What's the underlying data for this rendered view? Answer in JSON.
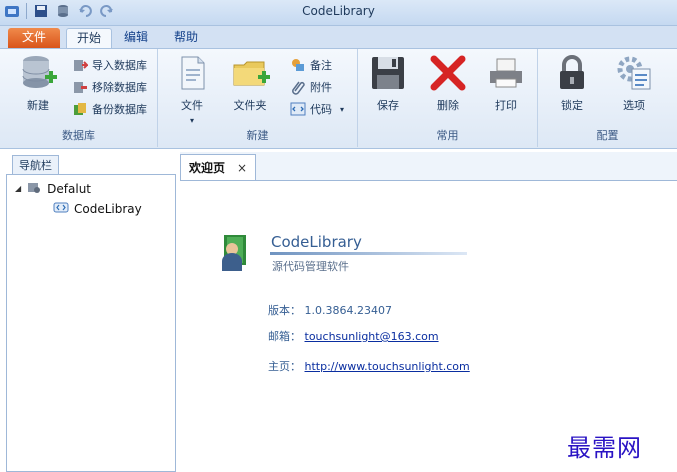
{
  "window": {
    "title": "CodeLibrary"
  },
  "ribbon_tabs": {
    "file": "文件",
    "home": "开始",
    "edit": "编辑",
    "help": "帮助"
  },
  "groups": {
    "database": {
      "label": "数据库",
      "new": "新建",
      "import": "导入数据库",
      "remove": "移除数据库",
      "backup": "备份数据库"
    },
    "create": {
      "label": "新建",
      "file": "文件",
      "folder": "文件夹",
      "note": "备注",
      "attachment": "附件",
      "code": "代码"
    },
    "common": {
      "label": "常用",
      "save": "保存",
      "delete": "删除",
      "print": "打印"
    },
    "config": {
      "label": "配置",
      "lock": "锁定",
      "options": "选项"
    }
  },
  "nav": {
    "header": "导航栏",
    "root": "Defalut",
    "child": "CodeLibray"
  },
  "doc_tab": {
    "label": "欢迎页",
    "close": "×"
  },
  "welcome": {
    "app_name": "CodeLibrary",
    "subtitle": "源代码管理软件",
    "version_label": "版本：",
    "version": "1.0.3864.23407",
    "email_label": "邮箱：",
    "email": "touchsunlight@163.com",
    "home_label": "主页：",
    "home_url": "http://www.touchsunlight.com"
  },
  "watermark": "最需网",
  "colors": {
    "file_tab": "#e06a2c",
    "ribbon_bg": "#dde8f5",
    "link": "#0a2ea0"
  }
}
